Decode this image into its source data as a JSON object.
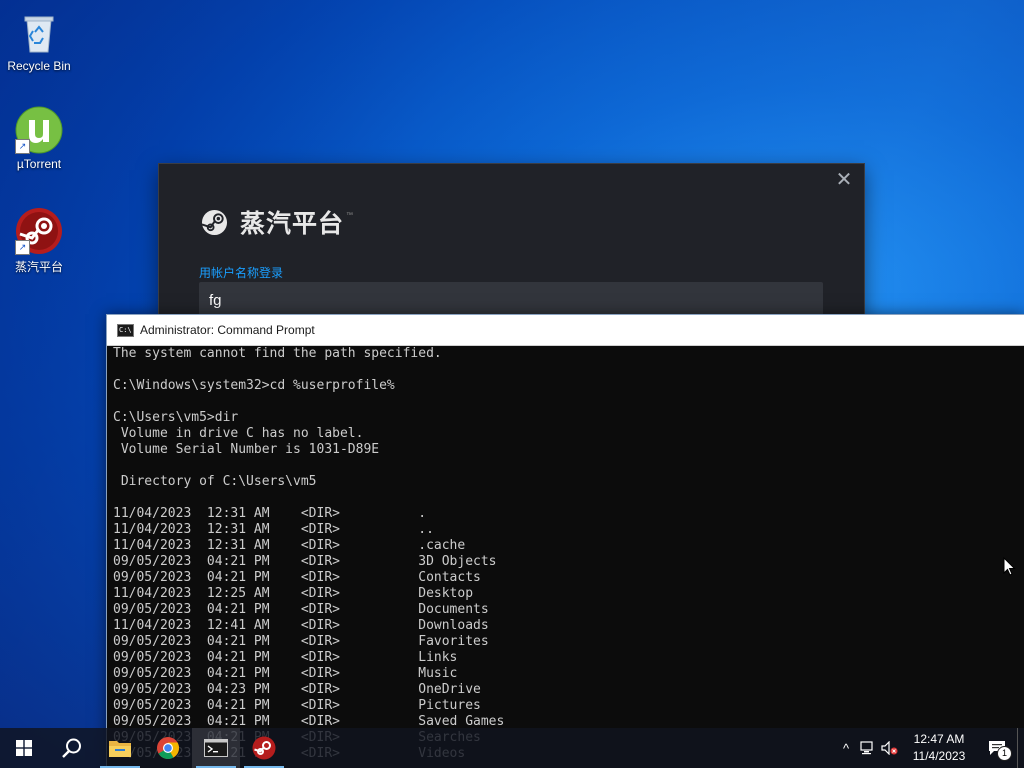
{
  "desktop": {
    "icons": [
      {
        "label": "Recycle Bin",
        "icon": "recycle-bin-icon"
      },
      {
        "label": "µTorrent",
        "icon": "utorrent-icon"
      },
      {
        "label": "蒸汽平台",
        "icon": "steam-icon"
      }
    ]
  },
  "steam": {
    "logo_text": "蒸汽平台",
    "login_label": "用帐户名称登录",
    "username_value": "fg",
    "close_glyph": "✕"
  },
  "cmd": {
    "title": "Administrator: Command Prompt",
    "lines": [
      "The system cannot find the path specified.",
      "",
      "C:\\Windows\\system32>cd %userprofile%",
      "",
      "C:\\Users\\vm5>dir",
      " Volume in drive C has no label.",
      " Volume Serial Number is 1031-D89E",
      "",
      " Directory of C:\\Users\\vm5",
      "",
      "11/04/2023  12:31 AM    <DIR>          .",
      "11/04/2023  12:31 AM    <DIR>          ..",
      "11/04/2023  12:31 AM    <DIR>          .cache",
      "09/05/2023  04:21 PM    <DIR>          3D Objects",
      "09/05/2023  04:21 PM    <DIR>          Contacts",
      "11/04/2023  12:25 AM    <DIR>          Desktop",
      "09/05/2023  04:21 PM    <DIR>          Documents",
      "11/04/2023  12:41 AM    <DIR>          Downloads",
      "09/05/2023  04:21 PM    <DIR>          Favorites",
      "09/05/2023  04:21 PM    <DIR>          Links",
      "09/05/2023  04:21 PM    <DIR>          Music",
      "09/05/2023  04:23 PM    <DIR>          OneDrive",
      "09/05/2023  04:21 PM    <DIR>          Pictures",
      "09/05/2023  04:21 PM    <DIR>          Saved Games",
      "09/05/2023  04:21 PM    <DIR>          Searches",
      "09/05/2023  04:21 PM    <DIR>          Videos"
    ]
  },
  "taskbar": {
    "buttons": [
      {
        "name": "start-button",
        "icon": "windows-icon"
      },
      {
        "name": "search-button",
        "icon": "search-icon"
      },
      {
        "name": "file-explorer-button",
        "icon": "folder-icon"
      },
      {
        "name": "chrome-button",
        "icon": "chrome-icon"
      },
      {
        "name": "cmd-taskbar-button",
        "icon": "cmd-icon"
      },
      {
        "name": "steam-taskbar-button",
        "icon": "steam-icon"
      }
    ],
    "clock": {
      "time": "12:47 AM",
      "date": "11/4/2023"
    },
    "notification_count": "1",
    "tray_overflow_glyph": "^"
  },
  "colors": {
    "steam_accent": "#1a9fff",
    "cmd_text": "#cccccc",
    "cmd_bg": "#0c0c0c",
    "taskbar_accent": "#76b9ed"
  }
}
